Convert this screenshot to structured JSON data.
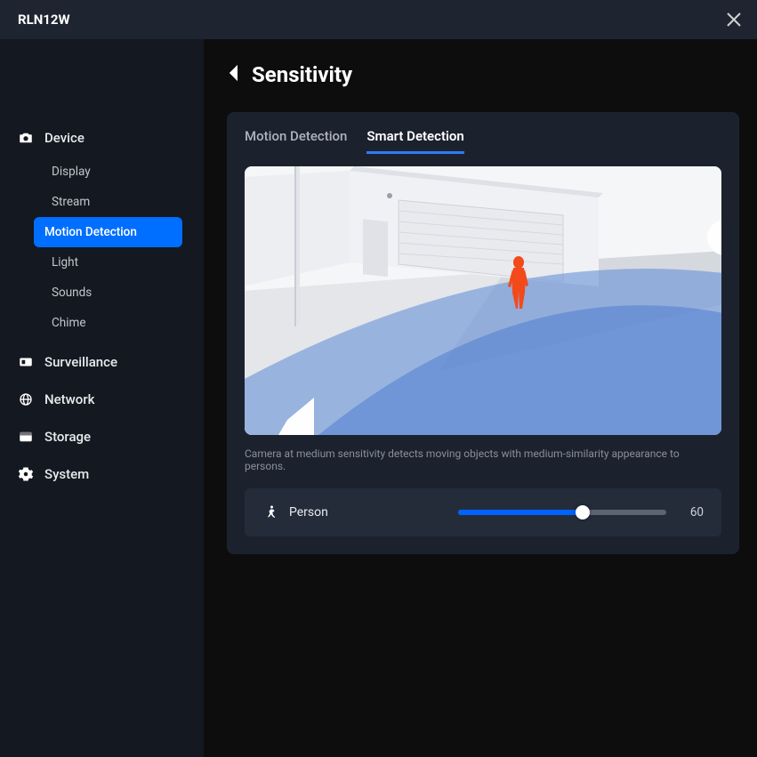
{
  "header": {
    "title": "RLN12W"
  },
  "sidebar": {
    "sections": [
      {
        "label": "Device",
        "expanded": true
      },
      {
        "label": "Surveillance",
        "expanded": false
      },
      {
        "label": "Network",
        "expanded": false
      },
      {
        "label": "Storage",
        "expanded": false
      },
      {
        "label": "System",
        "expanded": false
      }
    ],
    "device_items": [
      {
        "label": "Display"
      },
      {
        "label": "Stream"
      },
      {
        "label": "Motion Detection",
        "active": true
      },
      {
        "label": "Light"
      },
      {
        "label": "Sounds"
      },
      {
        "label": "Chime"
      }
    ]
  },
  "page": {
    "title": "Sensitivity"
  },
  "tabs": {
    "motion": "Motion Detection",
    "smart": "Smart Detection",
    "active": "smart"
  },
  "caption": "Camera at medium sensitivity detects moving objects with medium-similarity appearance to persons.",
  "slider": {
    "label": "Person",
    "value": 60
  },
  "colors": {
    "accent": "#006eff",
    "panel": "#1c222d",
    "card": "#242c3a"
  }
}
